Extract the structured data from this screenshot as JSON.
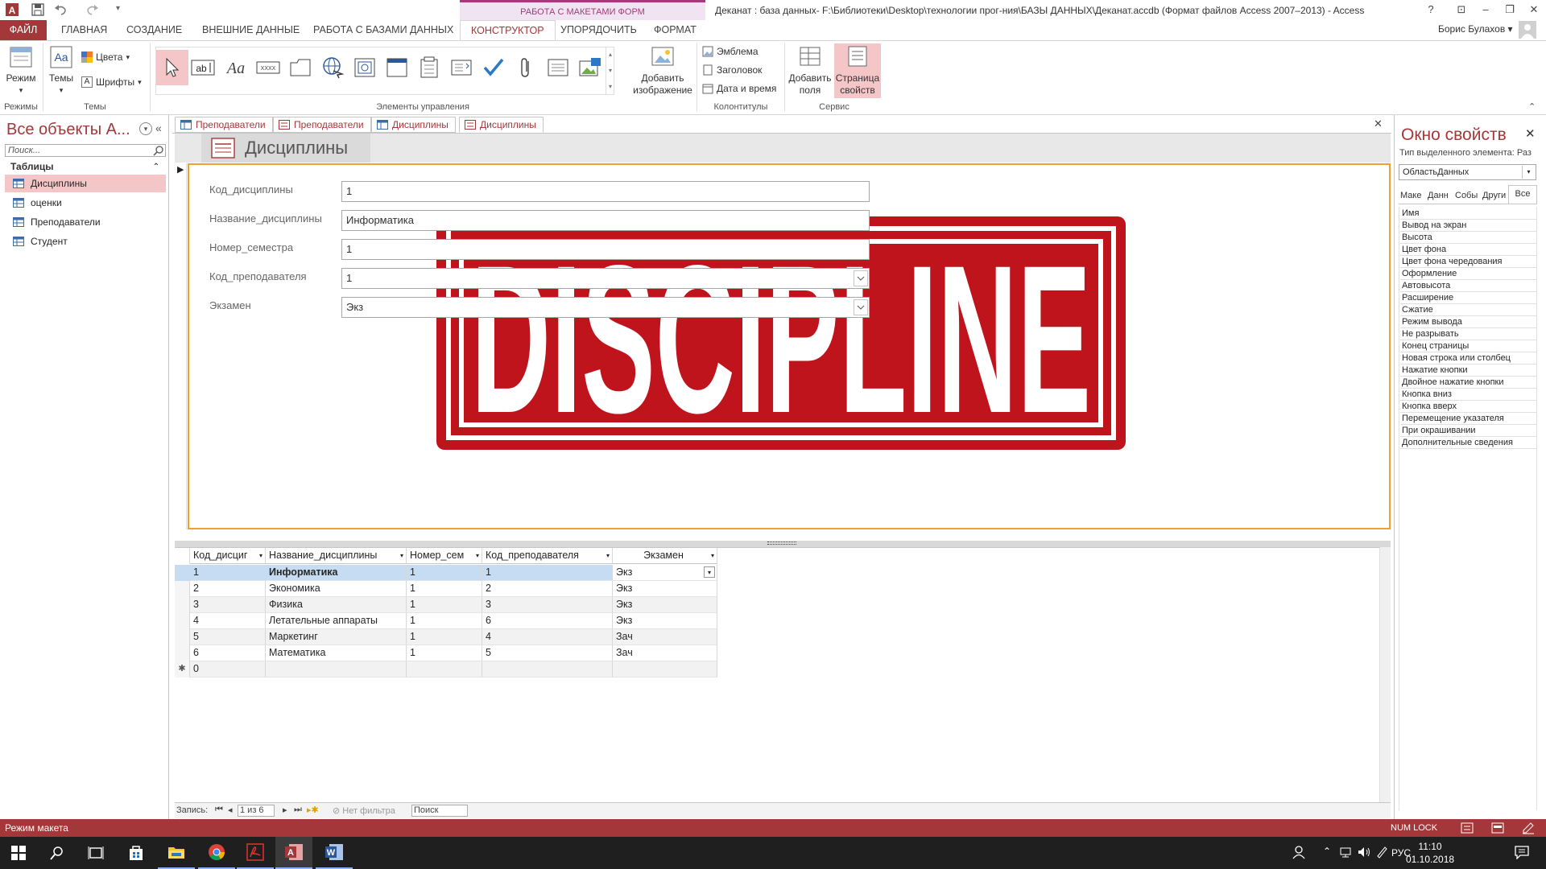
{
  "window": {
    "title": "Деканат : база данных- F:\\Библиотеки\\Desktop\\технологии прог-ния\\БАЗЫ ДАННЫХ\\Деканат.accdb (Формат файлов Access 2007–2013) - Access",
    "context_header": "РАБОТА С МАКЕТАМИ ФОРМ",
    "user": "Борис Булахов",
    "help": "?",
    "minimize": "–",
    "restore": "❐",
    "close": "✕"
  },
  "tabs": {
    "file": "ФАЙЛ",
    "home": "ГЛАВНАЯ",
    "create": "СОЗДАНИЕ",
    "external": "ВНЕШНИЕ ДАННЫЕ",
    "database": "РАБОТА С БАЗАМИ ДАННЫХ",
    "design": "КОНСТРУКТОР",
    "arrange": "УПОРЯДОЧИТЬ",
    "format": "ФОРМАТ"
  },
  "ribbon": {
    "mode": "Режим",
    "themes": "Темы",
    "colors": "Цвета",
    "fonts": "Шрифты",
    "add_image": "Добавить изображение",
    "logo": "Эмблема",
    "heading": "Заголовок",
    "datetime": "Дата и время",
    "add_fields": "Добавить поля",
    "prop_sheet": "Страница свойств",
    "groups": {
      "modes": "Режимы",
      "themes": "Темы",
      "controls": "Элементы управления",
      "headers": "Колонтитулы",
      "tools": "Сервис"
    }
  },
  "nav": {
    "title": "Все объекты A...",
    "search_placeholder": "Поиск...",
    "section": "Таблицы",
    "items": [
      "Дисциплины",
      "оценки",
      "Преподаватели",
      "Студент"
    ]
  },
  "doc_tabs": [
    "Преподаватели",
    "Преподаватели",
    "Дисциплины",
    "Дисциплины"
  ],
  "form": {
    "title": "Дисциплины",
    "fields": [
      {
        "label": "Код_дисциплины",
        "value": "1"
      },
      {
        "label": "Название_дисциплины",
        "value": "Информатика"
      },
      {
        "label": "Номер_семестра",
        "value": "1"
      },
      {
        "label": "Код_преподавателя",
        "value": "1"
      },
      {
        "label": "Экзамен",
        "value": "Экз"
      }
    ],
    "image_text": "DISCIPLINE"
  },
  "datasheet": {
    "headers": [
      "Код_дисциг",
      "Название_дисциплины",
      "Номер_сем",
      "Код_преподавателя",
      "Экзамен"
    ],
    "rows": [
      [
        "1",
        "Информатика",
        "1",
        "1",
        "Экз"
      ],
      [
        "2",
        "Экономика",
        "1",
        "2",
        "Экз"
      ],
      [
        "3",
        "Физика",
        "1",
        "3",
        "Экз"
      ],
      [
        "4",
        "Летательные аппараты",
        "1",
        "6",
        "Экз"
      ],
      [
        "5",
        "Маркетинг",
        "1",
        "4",
        "Зач"
      ],
      [
        "6",
        "Математика",
        "1",
        "5",
        "Зач"
      ]
    ],
    "new_row_marker": "✱",
    "new_row_value": "0"
  },
  "record_nav": {
    "label": "Запись:",
    "position": "1 из 6",
    "filter": "Нет фильтра",
    "search": "Поиск"
  },
  "props": {
    "title": "Окно свойств",
    "subtitle": "Тип выделенного элемента: Раз",
    "selector": "ОбластьДанных",
    "tabs": [
      "Маке",
      "Данн",
      "Собы",
      "Други",
      "Все"
    ],
    "items": [
      "Имя",
      "Вывод на экран",
      "Высота",
      "Цвет фона",
      "Цвет фона чередования",
      "Оформление",
      "Автовысота",
      "Расширение",
      "Сжатие",
      "Режим вывода",
      "Не разрывать",
      "Конец страницы",
      "Новая строка или столбец",
      "Нажатие кнопки",
      "Двойное нажатие кнопки",
      "Кнопка вниз",
      "Кнопка вверх",
      "Перемещение указателя",
      "При окрашивании",
      "Дополнительные сведения"
    ]
  },
  "status": {
    "mode": "Режим макета",
    "numlock": "NUM LOCK"
  },
  "taskbar": {
    "lang": "РУС",
    "time": "11:10",
    "date": "01.10.2018"
  },
  "colors": {
    "accent": "#a4373a",
    "context": "#a33a7a",
    "selection": "#f4c6c8",
    "form_border": "#f0a030",
    "stamp": "#c0141c"
  }
}
